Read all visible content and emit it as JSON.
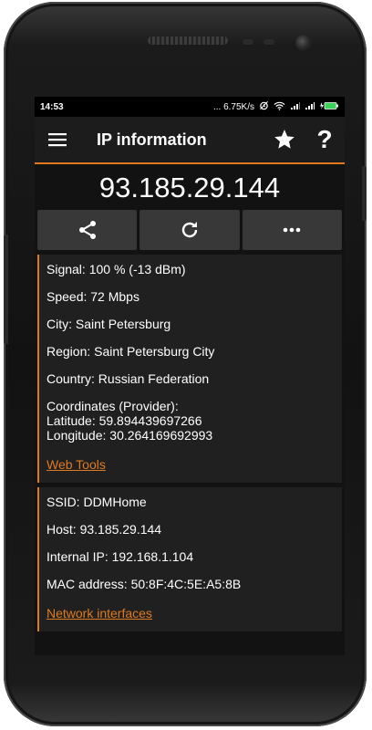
{
  "status_bar": {
    "time": "14:53",
    "speed": "... 6.75K/s",
    "icons": [
      "alarm-icon",
      "wifi-icon",
      "signal-icon",
      "signal-icon",
      "battery-charging-icon"
    ]
  },
  "app_bar": {
    "title": "IP information",
    "icons": [
      "menu-icon",
      "star-icon",
      "help-icon"
    ],
    "help_glyph": "?"
  },
  "ip_address": "93.185.29.144",
  "actions": [
    "share-icon",
    "refresh-icon",
    "more-icon"
  ],
  "info_card": {
    "signal": "Signal: 100 % (-13 dBm)",
    "speed": "Speed: 72 Mbps",
    "city": "City: Saint Petersburg",
    "region": "Region: Saint Petersburg City",
    "country": "Country: Russian Federation",
    "coordinates_label": "Coordinates (Provider):",
    "latitude": "Latitude: 59.894439697266",
    "longitude": "Longitude: 30.264169692993",
    "link": "Web Tools"
  },
  "network_card": {
    "ssid": "SSID: DDMHome",
    "host": "Host: 93.185.29.144",
    "internal_ip": "Internal IP: 192.168.1.104",
    "mac": "MAC address: 50:8F:4C:5E:A5:8B",
    "link": "Network interfaces"
  },
  "colors": {
    "accent": "#e07a1f",
    "background": "#121212",
    "card": "#202020",
    "button": "#383838"
  }
}
